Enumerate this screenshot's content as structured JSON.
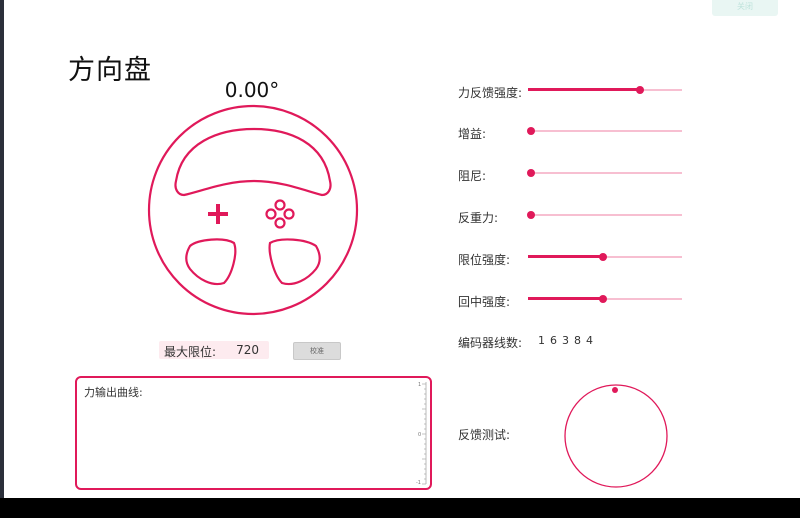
{
  "window": {
    "top_button_label": "关闭"
  },
  "steering": {
    "title": "方向盘",
    "angle": "0.00°",
    "max_limit_label": "最大限位:",
    "max_limit_value": "720",
    "calibrate_label": "校准"
  },
  "curve": {
    "label": "力输出曲线:",
    "ticks": [
      "1",
      "0",
      "-1"
    ]
  },
  "sliders": [
    {
      "label": "力反馈强度:",
      "value": 0.73
    },
    {
      "label": "增益:",
      "value": 0.02
    },
    {
      "label": "阻尼:",
      "value": 0.02
    },
    {
      "label": "反重力:",
      "value": 0.02
    },
    {
      "label": "限位强度:",
      "value": 0.49
    },
    {
      "label": "回中强度:",
      "value": 0.49
    }
  ],
  "encoder": {
    "label": "编码器线数:",
    "value": "16384"
  },
  "feedback_test": {
    "label": "反馈测试:"
  },
  "colors": {
    "accent": "#e0195a",
    "track": "#f7bfd1",
    "limit_bg": "#fdebef"
  }
}
